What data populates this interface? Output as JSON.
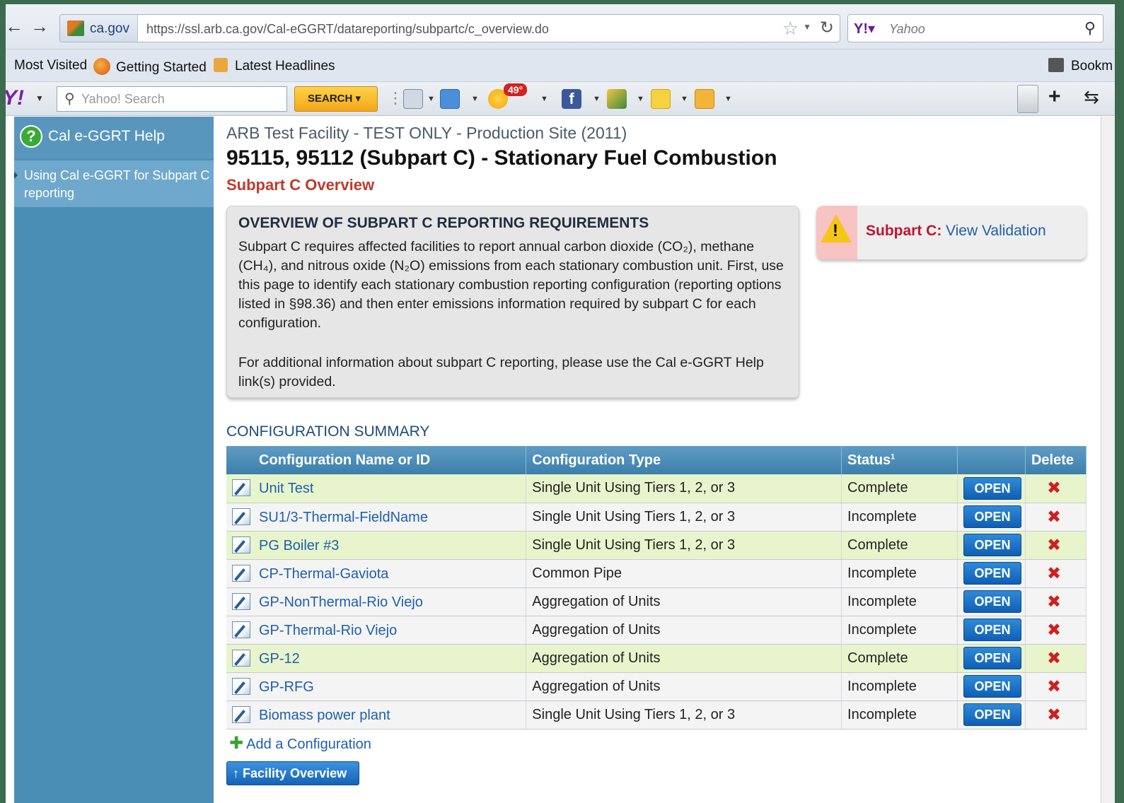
{
  "browser": {
    "site_domain": "ca.gov",
    "url": "https://ssl.arb.ca.gov/Cal-eGGRT/datareporting/subpartc/c_overview.do",
    "search_engine": "Yahoo",
    "bookmarks": {
      "most_visited": "Most Visited",
      "getting_started": "Getting Started",
      "latest_headlines": "Latest Headlines",
      "bookmarks": "Bookm"
    },
    "yahoo_toolbar": {
      "search_placeholder": "Yahoo! Search",
      "search_button": "SEARCH",
      "weather_temp": "49°"
    }
  },
  "sidebar": {
    "help_title": "Cal e-GGRT Help",
    "help_link": "Using Cal e-GGRT for Subpart C reporting"
  },
  "page": {
    "facility": "ARB Test Facility - TEST ONLY - Production Site (2011)",
    "title": "95115, 95112 (Subpart C) - Stationary Fuel Combustion",
    "subheading": "Subpart C Overview"
  },
  "overview": {
    "title": "OVERVIEW OF SUBPART C REPORTING REQUIREMENTS",
    "para1": "Subpart C requires affected facilities to report annual carbon dioxide (CO₂), methane (CH₄), and nitrous oxide (N₂O) emissions from each stationary combustion unit. First, use this page to identify each stationary combustion reporting configuration (reporting options listed in §98.36) and then enter emissions information required by subpart C for each configuration.",
    "para2": "For additional information about subpart C reporting, please use the Cal e-GGRT Help link(s) provided."
  },
  "validation": {
    "label": "Subpart C:",
    "link": "View Validation"
  },
  "config_summary": {
    "title": "CONFIGURATION SUMMARY",
    "headers": {
      "name": "Configuration Name or ID",
      "type": "Configuration Type",
      "status": "Status",
      "status_footnote": "1",
      "open": "",
      "delete": "Delete"
    },
    "open_label": "OPEN",
    "rows": [
      {
        "name": "Unit Test",
        "type": "Single Unit Using Tiers 1, 2, or 3",
        "status": "Complete"
      },
      {
        "name": "SU1/3-Thermal-FieldName",
        "type": "Single Unit Using Tiers 1, 2, or 3",
        "status": "Incomplete"
      },
      {
        "name": "PG Boiler #3",
        "type": "Single Unit Using Tiers 1, 2, or 3",
        "status": "Complete"
      },
      {
        "name": "CP-Thermal-Gaviota",
        "type": "Common Pipe",
        "status": "Incomplete"
      },
      {
        "name": "GP-NonThermal-Rio Viejo",
        "type": "Aggregation of Units",
        "status": "Incomplete"
      },
      {
        "name": "GP-Thermal-Rio Viejo",
        "type": "Aggregation of Units",
        "status": "Incomplete"
      },
      {
        "name": "GP-12",
        "type": "Aggregation of Units",
        "status": "Complete"
      },
      {
        "name": "GP-RFG",
        "type": "Aggregation of Units",
        "status": "Incomplete"
      },
      {
        "name": "Biomass power plant",
        "type": "Single Unit Using Tiers 1, 2, or 3",
        "status": "Incomplete"
      }
    ],
    "add_label": "Add a Configuration",
    "facility_overview_label": "Facility Overview"
  },
  "colors": {
    "sidebar": "#4a8db5",
    "complete_row": "#e8f5cc",
    "incomplete_row": "#f4f4f4",
    "subheading_red": "#c0392b",
    "link_blue": "#1f5fb0"
  }
}
